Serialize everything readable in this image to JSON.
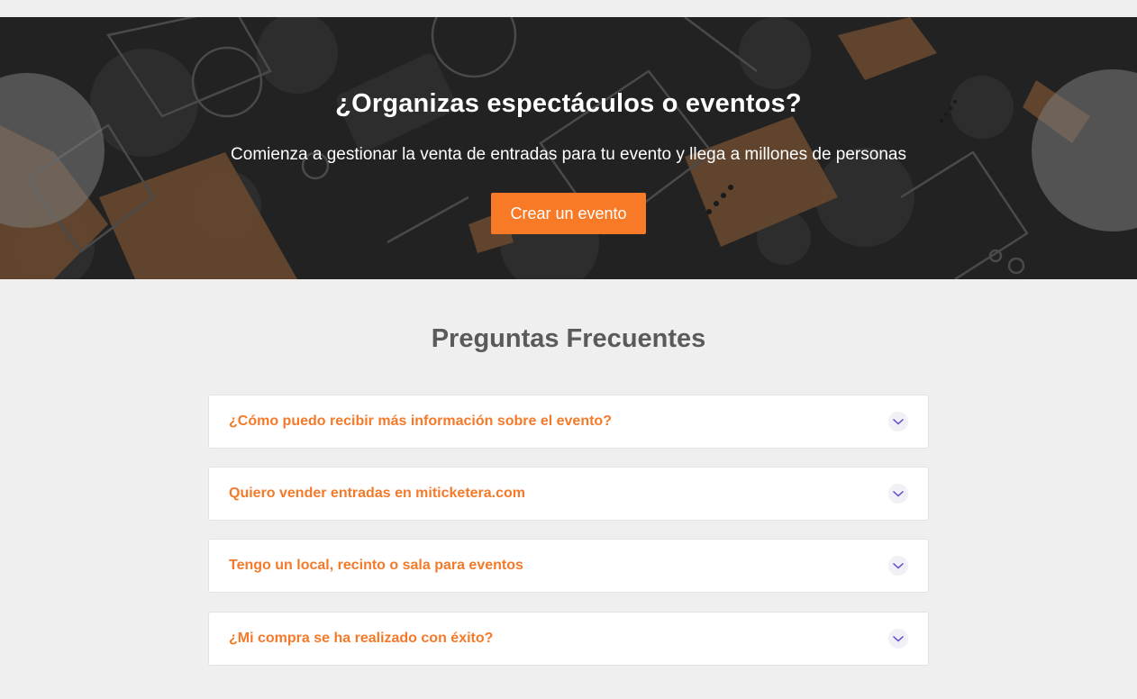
{
  "colors": {
    "accent": "#f97a26",
    "question_text": "#f47a2a",
    "hero_bg": "#232323",
    "page_bg": "#efefef",
    "chevron": "#5b46c9"
  },
  "hero": {
    "title": "¿Organizas espectáculos o eventos?",
    "subtitle": "Comienza a gestionar la venta de entradas para tu evento y llega a millones de personas",
    "cta_label": "Crear un evento"
  },
  "faq": {
    "title": "Preguntas Frecuentes",
    "toggle_icon": "chevron-down-icon",
    "items": [
      {
        "question": "¿Cómo puedo recibir más información sobre el evento?"
      },
      {
        "question": "Quiero vender entradas en miticketera.com"
      },
      {
        "question": "Tengo un local, recinto o sala para eventos"
      },
      {
        "question": "¿Mi compra se ha realizado con éxito?"
      }
    ]
  }
}
